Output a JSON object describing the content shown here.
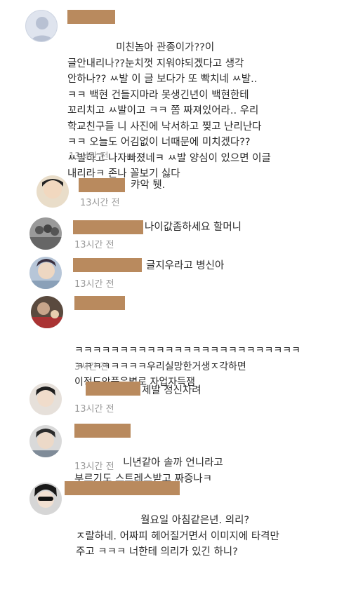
{
  "comments": [
    {
      "lines": [
        "               미친놈아 관종이가??이",
        "글안내리나??눈치껏 지워야되겠다고 생각",
        "안하나?? ㅆ발 이 글 보다가 또 빡치네 ㅆ발..",
        "ㅋㅋ 백현 건들지마라 못생긴년이 백현한테",
        "꼬리치고 ㅆ발이고 ㅋㅋ 쫌 짜져있어라.. 우리",
        "학교친구들 니 사진에 낙서하고 찢고 난리난다",
        "ㅋㅋ 오늘도 어김없이 너때문에 미치겠다??",
        "ㅆ발하고 나자빠졌네ㅋ ㅆ발 양심이 있으면 이글",
        "내리라ㅋ 존나 꼴보기 싫다"
      ],
      "time": "13시간 전"
    },
    {
      "lines": [
        "캬악 퉷."
      ],
      "time": "13시간 전"
    },
    {
      "lines": [
        "나이값좀하세요 할머니"
      ],
      "time": "13시간 전"
    },
    {
      "lines": [
        "글지우라고 병신아"
      ],
      "time": "13시간 전"
    },
    {
      "lines": [
        "ㅋㅋㅋㅋㅋㅋㅋㅋㅋㅋㅋㅋㅋㅋㅋㅋㅋㅋㅋㅋㅋㅋㅋㅋㅋ",
        "ㅋㅋㅋㅋㅋㅋㅋㅋ우리실망한거생ㅈ각하면",
        "이정도악플은별로 자업자득잼"
      ],
      "time": "3시간 전"
    },
    {
      "lines": [
        "제발 정신차려"
      ],
      "time": "13시간 전"
    },
    {
      "lines": [
        "               니년같아 솔까 언니라고",
        "부르기도 스트레스받고 짜증나ㅋ"
      ],
      "time": "13시간 전"
    },
    {
      "lines": [
        "                    월요일 아침같은년. 의리?",
        "ㅈ랄하네. 어짜피 헤어질거면서 이미지에 타격만",
        "주고 ㅋㅋㅋ 너한테 의리가 있긴 하니?"
      ],
      "time": ""
    }
  ],
  "colors": {
    "redaction": "#b98a5e",
    "time": "#9a9a9a"
  }
}
